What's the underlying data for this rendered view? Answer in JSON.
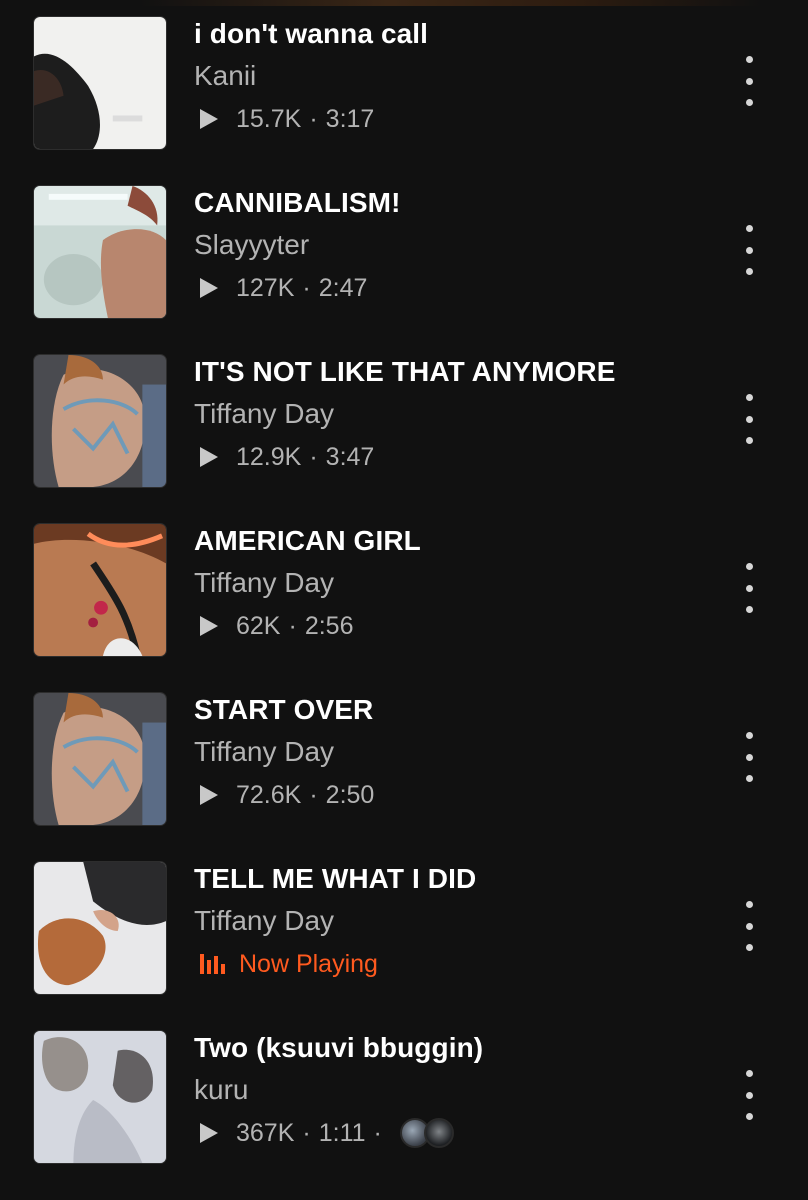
{
  "tracks": [
    {
      "title": "i don't wanna call",
      "artist": "Kanii",
      "plays": "15.7K",
      "duration": "3:17",
      "now_playing": false
    },
    {
      "title": "CANNIBALISM!",
      "artist": "Slayyyter",
      "plays": "127K",
      "duration": "2:47",
      "now_playing": false
    },
    {
      "title": "IT'S NOT LIKE THAT ANYMORE",
      "artist": "Tiffany Day",
      "plays": "12.9K",
      "duration": "3:47",
      "now_playing": false
    },
    {
      "title": "AMERICAN GIRL",
      "artist": "Tiffany Day",
      "plays": "62K",
      "duration": "2:56",
      "now_playing": false
    },
    {
      "title": "START OVER",
      "artist": "Tiffany Day",
      "plays": "72.6K",
      "duration": "2:50",
      "now_playing": false
    },
    {
      "title": "TELL ME WHAT I DID",
      "artist": "Tiffany Day",
      "status": "Now Playing",
      "now_playing": true
    },
    {
      "title": "Two (ksuuvi bbuggin)",
      "artist": "kuru",
      "plays": "367K",
      "duration": "1:11",
      "now_playing": false
    }
  ],
  "separator": "·",
  "colors": {
    "background": "#111111",
    "title": "#ffffff",
    "secondary_text": "#b3b3b3",
    "accent_now_playing": "#ff5a1f"
  },
  "icons": {
    "play": "play-icon",
    "more": "more-vertical-icon",
    "now_playing": "equalizer-icon"
  }
}
